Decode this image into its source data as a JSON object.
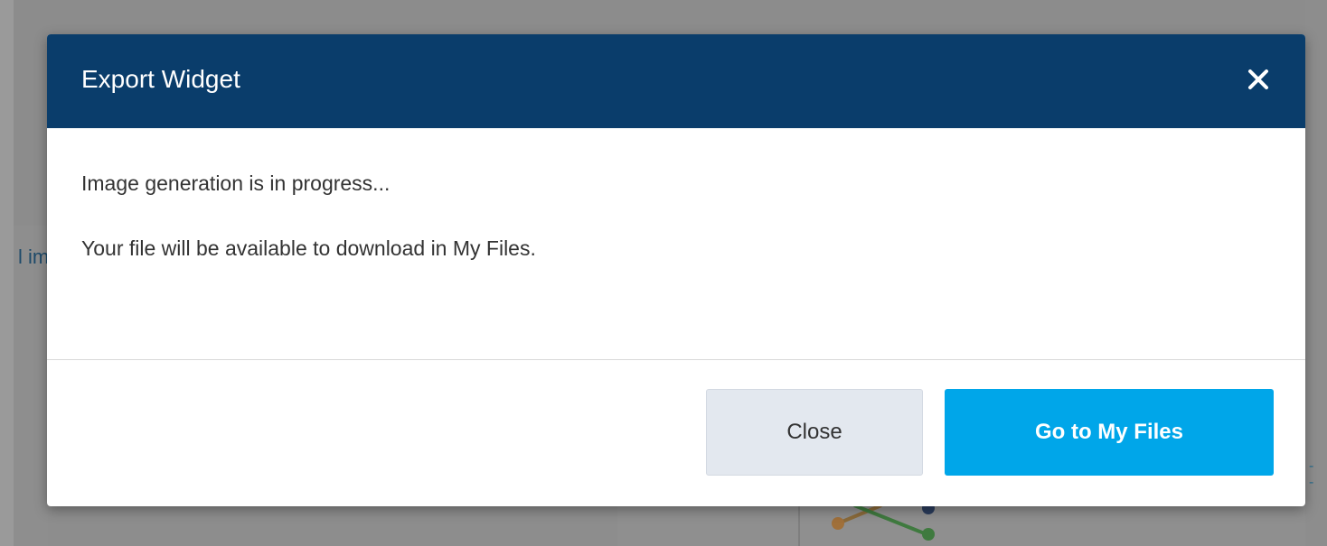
{
  "background": {
    "peek_text": "l im"
  },
  "dialog": {
    "title": "Export Widget",
    "close_icon": "close-icon",
    "message_line1": "Image generation is in progress...",
    "message_line2": "Your file will be available to download in My Files.",
    "buttons": {
      "close_label": "Close",
      "primary_label": "Go to My Files"
    }
  },
  "colors": {
    "header_bg": "#0a3d6b",
    "primary_button": "#00a6e9",
    "secondary_button": "#e3e8ef",
    "overlay": "#8a8a8a"
  }
}
